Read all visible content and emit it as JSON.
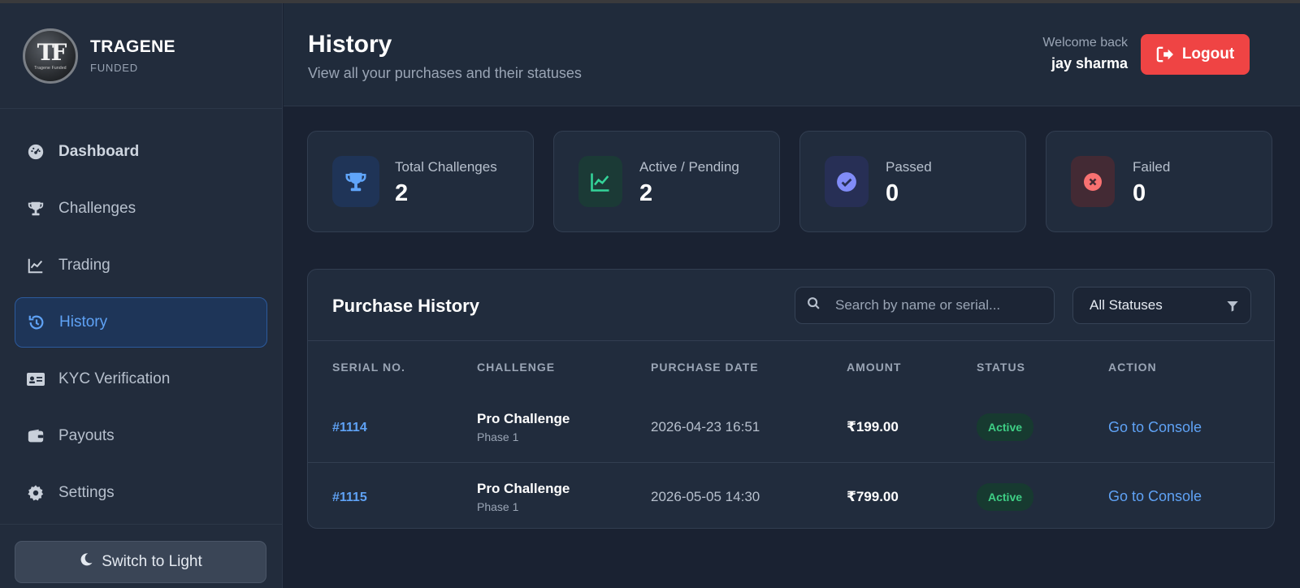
{
  "brand": {
    "mark": "TF",
    "mark_small": "Tragene Funded",
    "name": "TRAGENE",
    "sub": "FUNDED"
  },
  "sidebar": {
    "items": [
      {
        "label": "Dashboard",
        "icon": "gauge-icon"
      },
      {
        "label": "Challenges",
        "icon": "trophy-icon"
      },
      {
        "label": "Trading",
        "icon": "chart-line-icon"
      },
      {
        "label": "History",
        "icon": "history-icon",
        "active": true
      },
      {
        "label": "KYC Verification",
        "icon": "id-card-icon"
      },
      {
        "label": "Payouts",
        "icon": "wallet-icon"
      },
      {
        "label": "Settings",
        "icon": "gear-icon"
      }
    ],
    "theme_toggle": "Switch to Light"
  },
  "header": {
    "title": "History",
    "subtitle": "View all your purchases and their statuses",
    "welcome": "Welcome back",
    "user": "jay sharma",
    "logout": "Logout"
  },
  "stats": [
    {
      "label": "Total Challenges",
      "value": "2",
      "icon": "trophy-icon",
      "color": "#60a5fa"
    },
    {
      "label": "Active / Pending",
      "value": "2",
      "icon": "chart-line-icon",
      "color": "#34d399"
    },
    {
      "label": "Passed",
      "value": "0",
      "icon": "check-circle-icon",
      "color": "#818cf8"
    },
    {
      "label": "Failed",
      "value": "0",
      "icon": "x-circle-icon",
      "color": "#f87171"
    }
  ],
  "history": {
    "title": "Purchase History",
    "search_placeholder": "Search by name or serial...",
    "filter": "All Statuses",
    "columns": [
      "SERIAL NO.",
      "CHALLENGE",
      "PURCHASE DATE",
      "AMOUNT",
      "STATUS",
      "ACTION"
    ],
    "rows": [
      {
        "serial": "#1114",
        "challenge": "Pro Challenge",
        "phase": "Phase 1",
        "date": "2026-04-23 16:51",
        "amount": "₹199.00",
        "status": "Active",
        "action": "Go to Console"
      },
      {
        "serial": "#1115",
        "challenge": "Pro Challenge",
        "phase": "Phase 1",
        "date": "2026-05-05 14:30",
        "amount": "₹799.00",
        "status": "Active",
        "action": "Go to Console"
      }
    ]
  },
  "colors": {
    "accent": "#5fa2f5",
    "danger": "#ef4444",
    "success": "#3ecf85"
  }
}
